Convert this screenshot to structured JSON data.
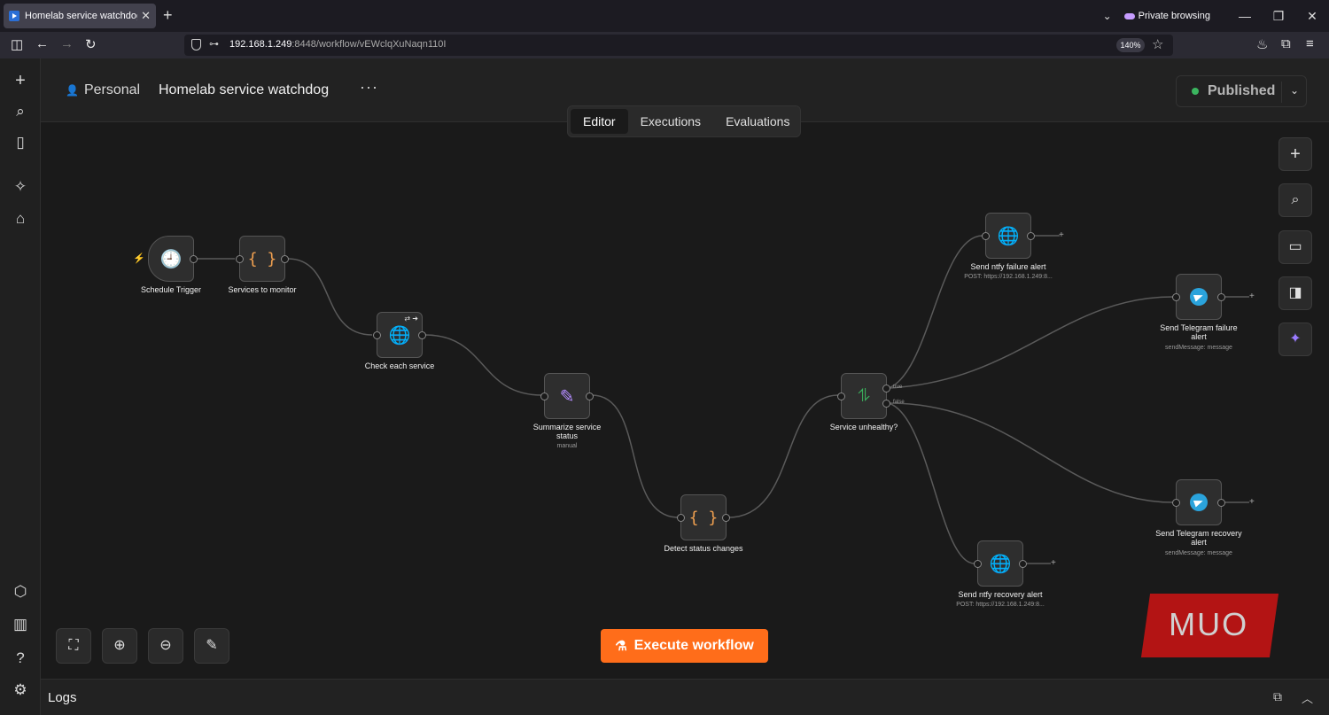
{
  "browser": {
    "tab_title": "Homelab service watchdog",
    "url_host": "192.168.1.249",
    "url_rest": ":8448/workflow/vEWclqXuNaqn110I",
    "zoom": "140%",
    "private_label": "Private browsing"
  },
  "header": {
    "project": "Personal",
    "workflow_name": "Homelab service watchdog",
    "more": "···",
    "status": "Published"
  },
  "tabs": [
    "Editor",
    "Executions",
    "Evaluations"
  ],
  "nodes": {
    "schedule": {
      "label": "Schedule Trigger"
    },
    "services": {
      "label": "Services to monitor"
    },
    "check": {
      "label": "Check each service"
    },
    "summarize": {
      "label": "Summarize service status",
      "sub": "manual"
    },
    "detect": {
      "label": "Detect status changes"
    },
    "unhealthy": {
      "label": "Service unhealthy?",
      "true_label": "true",
      "false_label": "false"
    },
    "ntfy_fail": {
      "label": "Send ntfy failure alert",
      "sub": "POST: https://192.168.1.249:8..."
    },
    "tg_fail": {
      "label": "Send Telegram failure alert",
      "sub": "sendMessage: message"
    },
    "tg_recover": {
      "label": "Send Telegram recovery alert",
      "sub": "sendMessage: message"
    },
    "ntfy_recover": {
      "label": "Send ntfy recovery alert",
      "sub": "POST: https://192.168.1.249:8..."
    }
  },
  "execute_label": "Execute workflow",
  "logs_label": "Logs",
  "watermark": "MUO",
  "colors": {
    "accent": "#ff6d1a",
    "published_dot": "#3bb55f",
    "edge": "#5a5a5a"
  }
}
